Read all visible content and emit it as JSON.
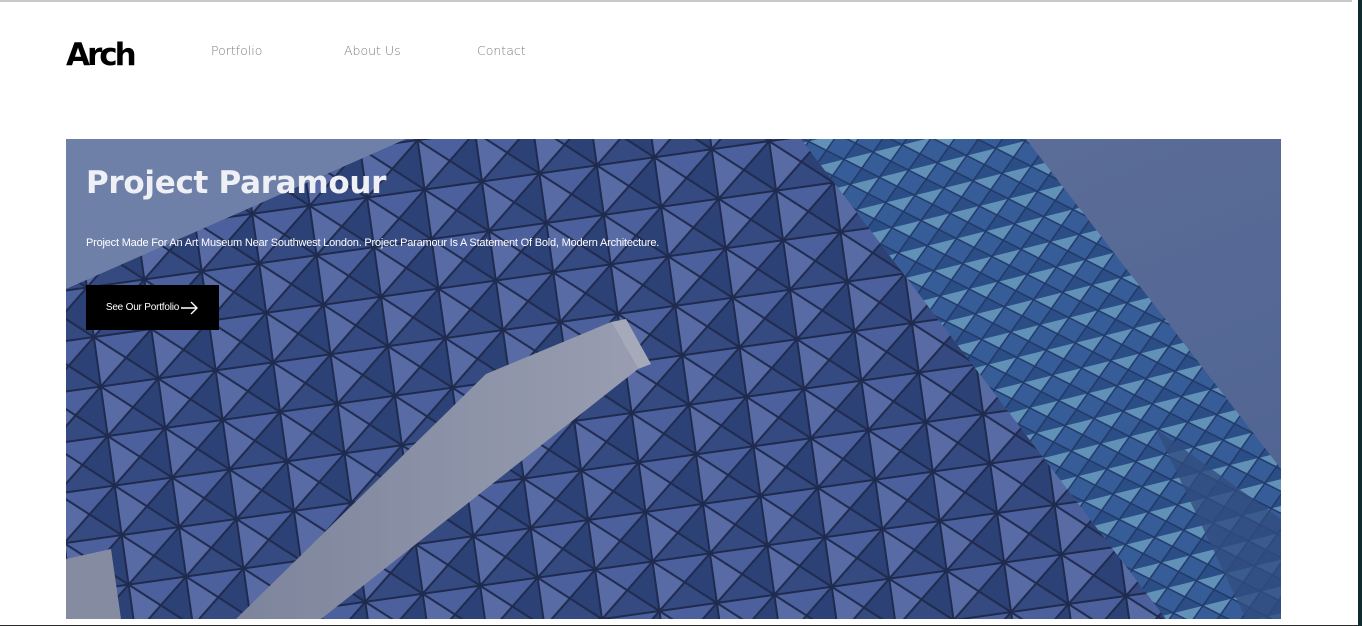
{
  "brand": {
    "logo_text": "Arch"
  },
  "nav": {
    "items": [
      {
        "label": "Portfolio"
      },
      {
        "label": "About Us"
      },
      {
        "label": "Contact"
      }
    ]
  },
  "hero": {
    "title": "Project Paramour",
    "description": "Project Made For An Art Museum Near Southwest London. Project Paramour Is A Statement Of Bold, Modern Architecture.",
    "cta_label": "See Our Portfolio",
    "cta_icon": "arrow-right-icon",
    "image_subject": "blue-glass-building-facade"
  },
  "colors": {
    "cta_background": "#000000",
    "nav_text": "#7c7c7c",
    "facade_blue": "#3e5b8f"
  }
}
